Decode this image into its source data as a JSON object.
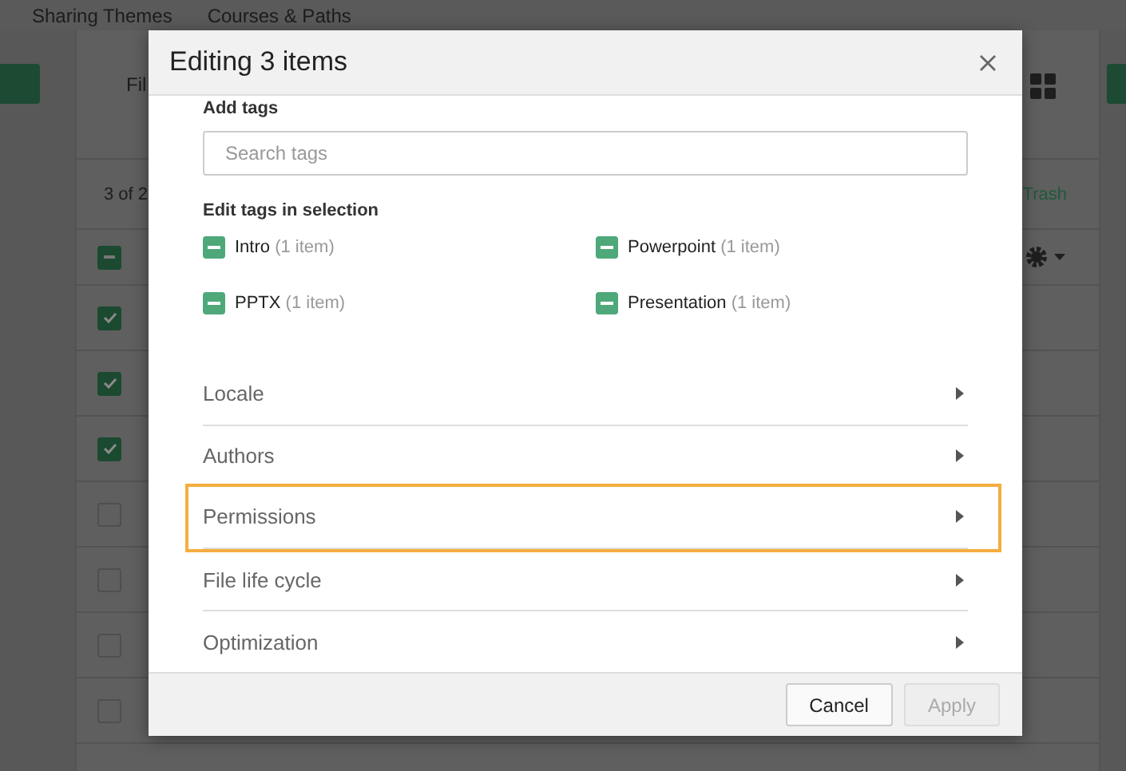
{
  "nav": [
    "Sharing Themes",
    "Courses & Paths"
  ],
  "toolbar": {
    "label": "Fil"
  },
  "list": {
    "count": "3 of 2",
    "trash": "Trash",
    "header_indeterminate": true,
    "rows": [
      {
        "checked": true
      },
      {
        "checked": true
      },
      {
        "checked": true
      },
      {
        "checked": false
      },
      {
        "checked": false
      },
      {
        "checked": false
      },
      {
        "checked": false
      }
    ]
  },
  "dialog": {
    "title": "Editing 3 items",
    "add_tags": {
      "label": "Add tags",
      "placeholder": "Search tags"
    },
    "edit_tags": {
      "label": "Edit tags in selection",
      "tags": [
        {
          "name": "Intro",
          "count": "(1 item)",
          "indeterminate": true
        },
        {
          "name": "Powerpoint",
          "count": "(1 item)",
          "indeterminate": true
        },
        {
          "name": "PPTX",
          "count": "(1 item)",
          "indeterminate": true
        },
        {
          "name": "Presentation",
          "count": "(1 item)",
          "indeterminate": true
        }
      ]
    },
    "sections": [
      {
        "label": "Locale",
        "highlighted": false
      },
      {
        "label": "Authors",
        "highlighted": false
      },
      {
        "label": "Permissions",
        "highlighted": true
      },
      {
        "label": "File life cycle",
        "highlighted": false
      },
      {
        "label": "Optimization",
        "highlighted": false
      }
    ],
    "buttons": [
      {
        "label": "Cancel",
        "disabled": false
      },
      {
        "label": "Apply",
        "disabled": true
      }
    ]
  }
}
